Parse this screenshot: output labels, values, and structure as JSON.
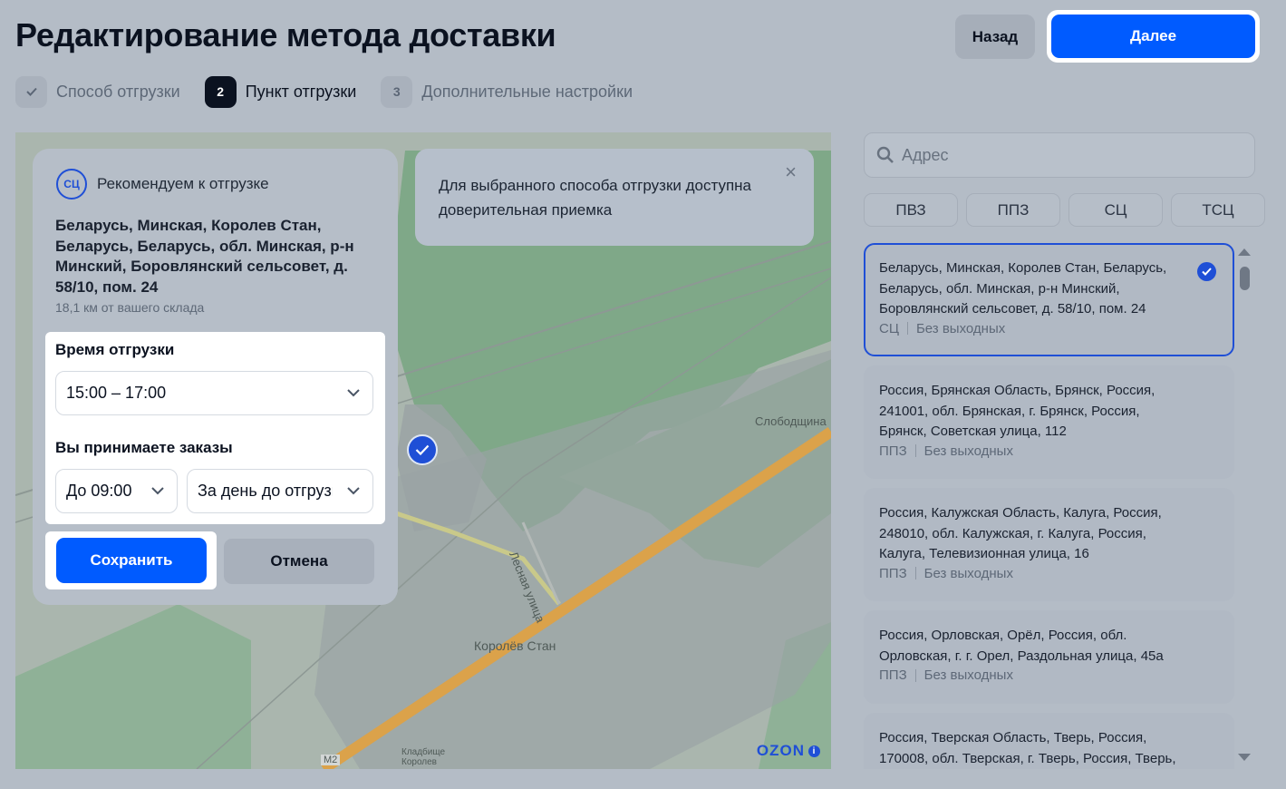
{
  "header": {
    "title": "Редактирование метода доставки",
    "back_label": "Назад",
    "next_label": "Далее"
  },
  "steps": [
    {
      "badge": "✓",
      "label": "Способ отгрузки",
      "state": "done"
    },
    {
      "badge": "2",
      "label": "Пункт отгрузки",
      "state": "active"
    },
    {
      "badge": "3",
      "label": "Дополнительные настройки",
      "state": "pending"
    }
  ],
  "map": {
    "labels": {
      "sloboda": "Слободщина",
      "lesnaya": "Лесная улица",
      "korolev": "Королёв Стан",
      "m2": "М2",
      "cemetery": "Кладбище\nКоролев"
    },
    "logo": "OZON",
    "info_glyph": "i",
    "colors": {
      "forest": "#7fa888",
      "field": "#aab6ae",
      "road": "#dba24a",
      "built": "#9aa3a4"
    }
  },
  "recommend": {
    "badge": "СЦ",
    "title": "Рекомендуем к отгрузке",
    "address": "Беларусь, Минская, Королев Стан, Беларусь, Беларусь, обл. Минская, р-н Минский, Боровлянский сельсовет, д. 58/10, пом. 24",
    "distance": "18,1 км от вашего склада",
    "ship_time_label": "Время отгрузки",
    "ship_time_value": "15:00 – 17:00",
    "accept_label": "Вы принимаете заказы",
    "accept_until": "До 09:00",
    "accept_day": "За день до отгрузки",
    "save_label": "Сохранить",
    "cancel_label": "Отмена"
  },
  "banner": {
    "text": "Для выбранного способа отгрузки доступна доверительная приемка",
    "close": "×"
  },
  "search": {
    "placeholder": "Адрес"
  },
  "filters": [
    "ПВЗ",
    "ППЗ",
    "СЦ",
    "ТСЦ"
  ],
  "points": [
    {
      "address": "Беларусь, Минская, Королев Стан, Беларусь, Беларусь, обл. Минская, р-н Минский, Боровлянский сельсовет, д. 58/10, пом. 24",
      "type": "СЦ",
      "schedule": "Без выходных",
      "selected": true
    },
    {
      "address": "Россия, Брянская Область, Брянск, Россия, 241001, обл. Брянская, г. Брянск, Россия, Брянск, Советская улица, 112",
      "type": "ППЗ",
      "schedule": "Без выходных",
      "selected": false
    },
    {
      "address": "Россия, Калужская Область, Калуга, Россия, 248010, обл. Калужская, г. Калуга, Россия, Калуга, Телевизионная улица, 16",
      "type": "ППЗ",
      "schedule": "Без выходных",
      "selected": false
    },
    {
      "address": "Россия, Орловская, Орёл, Россия, обл. Орловская, г. г. Орел, Раздольная улица, 45а",
      "type": "ППЗ",
      "schedule": "Без выходных",
      "selected": false
    },
    {
      "address": "Россия, Тверская Область, Тверь, Россия, 170008, обл. Тверская, г. Тверь, Россия, Тверь,",
      "type": "",
      "schedule": "",
      "selected": false
    }
  ],
  "accent_color": "#005bff"
}
